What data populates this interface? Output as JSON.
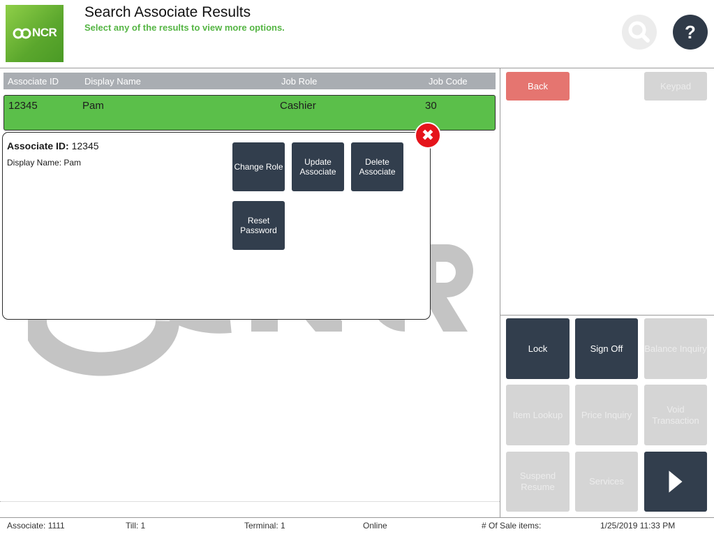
{
  "header": {
    "logo_text": "NCR",
    "title": "Search Associate Results",
    "subtitle": "Select any of the results to view more options.",
    "help_label": "?"
  },
  "table": {
    "columns": [
      "Associate ID",
      "Display Name",
      "Job Role",
      "Job Code"
    ],
    "rows": [
      {
        "associate_id": "12345",
        "display_name": "Pam",
        "job_role": "Cashier",
        "job_code": "30"
      }
    ]
  },
  "popup": {
    "id_label": "Associate ID:",
    "id_value": "12345",
    "name_line": "Display Name: Pam",
    "buttons": {
      "change_role": "Change Role",
      "update_associate": "Update Associate",
      "delete_associate": "Delete Associate",
      "reset_password": "Reset Password"
    },
    "close_symbol": "✖"
  },
  "right_panel": {
    "back": "Back",
    "keypad": "Keypad",
    "lock": "Lock",
    "sign_off": "Sign Off",
    "balance_inquiry": "Balance Inquiry",
    "item_lookup": "Item Lookup",
    "price_inquiry": "Price Inquiry",
    "void_transaction": "Void Transaction",
    "suspend_resume": "Suspend Resume",
    "services": "Services"
  },
  "status_bar": {
    "associate": "Associate: 1111",
    "till": "Till: 1",
    "terminal": "Terminal: 1",
    "connection": "Online",
    "sale_items": "# Of Sale items:",
    "datetime": "1/25/2019 11:33 PM"
  },
  "colors": {
    "brand_green": "#5bbf4a",
    "dark_button": "#323e4d",
    "back_red": "#e57570",
    "close_red": "#e5141b"
  }
}
